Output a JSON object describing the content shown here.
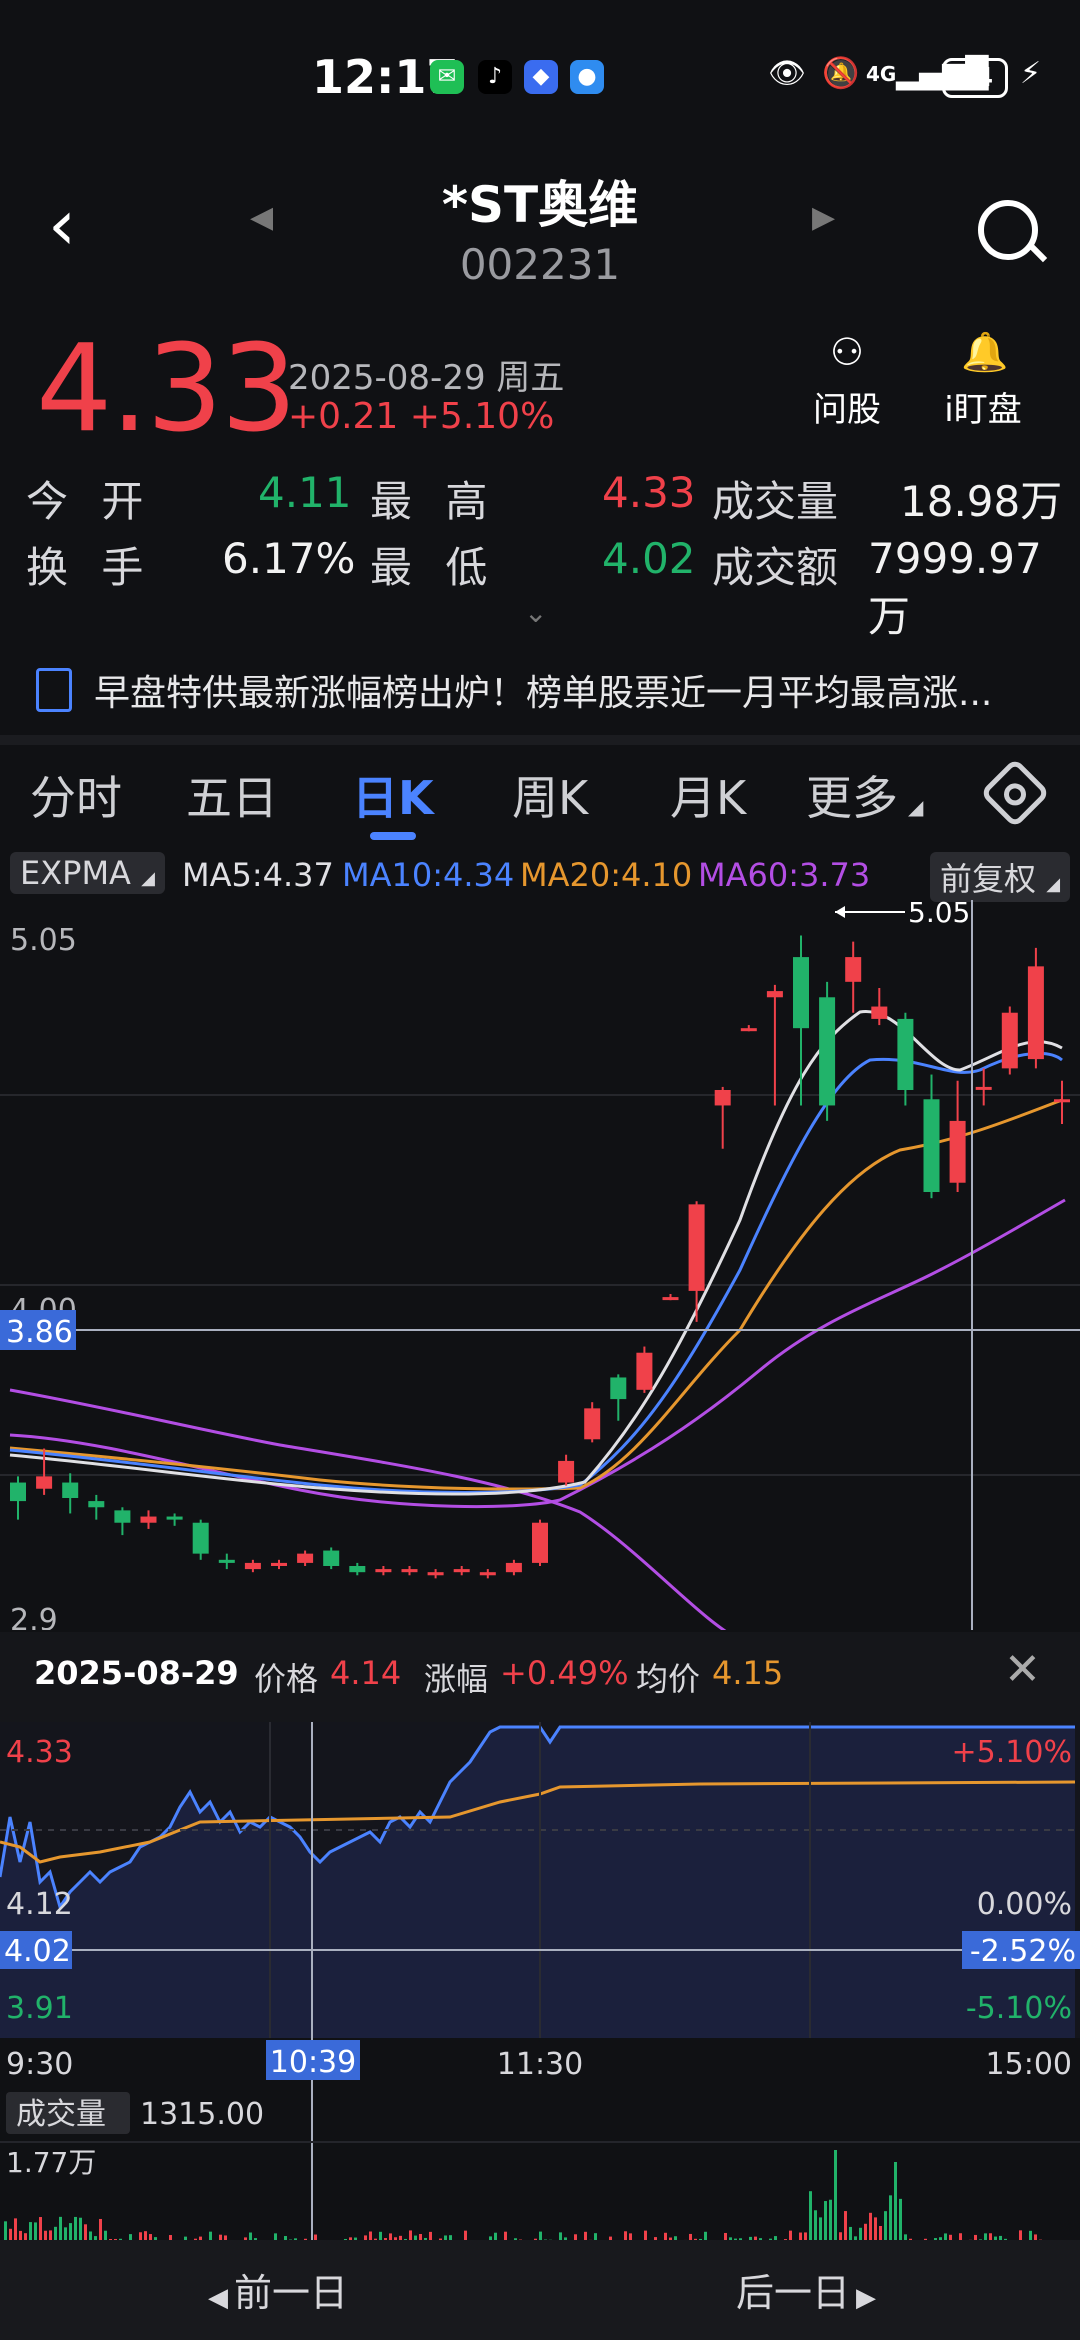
{
  "status_bar": {
    "time": "12:17",
    "apps": [
      "wechat-icon",
      "tiktok-icon",
      "baidu-icon",
      "browser-icon"
    ],
    "network": "4G",
    "battery": "94"
  },
  "header": {
    "title": "*ST奥维",
    "code": "002231"
  },
  "quote": {
    "price": "4.33",
    "date": "2025-08-29 周五",
    "change": "+0.21 +5.10%",
    "ask_label": "问股",
    "watch_label": "i盯盘"
  },
  "stats": {
    "open_label": "今 开",
    "open": "4.11",
    "high_label": "最 高",
    "high": "4.33",
    "volume_label": "成交量",
    "volume": "18.98万",
    "turnover_label": "换 手",
    "turnover": "6.17%",
    "low_label": "最 低",
    "low": "4.02",
    "amount_label": "成交额",
    "amount": "7999.97万"
  },
  "news": {
    "text": "早盘特供最新涨幅榜出炉！榜单股票近一月平均最高涨..."
  },
  "tabs": [
    {
      "label": "分时"
    },
    {
      "label": "五日"
    },
    {
      "label": "日K"
    },
    {
      "label": "周K"
    },
    {
      "label": "月K"
    },
    {
      "label": "更多"
    }
  ],
  "indicators": {
    "expma": "EXPMA",
    "ma5": "MA5:4.37",
    "ma10": "MA10:4.34",
    "ma20": "MA20:4.10",
    "ma60": "MA60:3.73",
    "adjust": "前复权",
    "colors": {
      "ma5": "#e0e0e4",
      "ma10": "#4b83ff",
      "ma20": "#e6972e",
      "ma60": "#b34ee4"
    }
  },
  "kline": {
    "y_top": "5.05",
    "y_mid": "4.00",
    "y_bottom": "2.9",
    "cursor_value": "3.86",
    "max_label": "5.05",
    "ylim": [
      2.9,
      5.1
    ],
    "candles": [
      {
        "o": 3.28,
        "c": 3.22,
        "h": 3.3,
        "l": 3.16
      },
      {
        "o": 3.26,
        "c": 3.3,
        "h": 3.39,
        "l": 3.24
      },
      {
        "o": 3.28,
        "c": 3.23,
        "h": 3.31,
        "l": 3.18
      },
      {
        "o": 3.22,
        "c": 3.2,
        "h": 3.24,
        "l": 3.16
      },
      {
        "o": 3.19,
        "c": 3.15,
        "h": 3.2,
        "l": 3.11
      },
      {
        "o": 3.15,
        "c": 3.17,
        "h": 3.19,
        "l": 3.13
      },
      {
        "o": 3.17,
        "c": 3.16,
        "h": 3.18,
        "l": 3.14
      },
      {
        "o": 3.15,
        "c": 3.05,
        "h": 3.16,
        "l": 3.03
      },
      {
        "o": 3.03,
        "c": 3.02,
        "h": 3.05,
        "l": 3.0
      },
      {
        "o": 3.0,
        "c": 3.02,
        "h": 3.03,
        "l": 2.99
      },
      {
        "o": 3.01,
        "c": 3.02,
        "h": 3.03,
        "l": 3.0
      },
      {
        "o": 3.02,
        "c": 3.05,
        "h": 3.06,
        "l": 3.01
      },
      {
        "o": 3.06,
        "c": 3.01,
        "h": 3.07,
        "l": 3.0
      },
      {
        "o": 3.01,
        "c": 2.99,
        "h": 3.02,
        "l": 2.98
      },
      {
        "o": 2.99,
        "c": 3.0,
        "h": 3.01,
        "l": 2.98
      },
      {
        "o": 2.99,
        "c": 3.0,
        "h": 3.01,
        "l": 2.98
      },
      {
        "o": 2.98,
        "c": 2.99,
        "h": 3.0,
        "l": 2.97
      },
      {
        "o": 2.99,
        "c": 3.0,
        "h": 3.01,
        "l": 2.98
      },
      {
        "o": 2.98,
        "c": 2.99,
        "h": 3.0,
        "l": 2.97
      },
      {
        "o": 2.99,
        "c": 3.02,
        "h": 3.03,
        "l": 2.98
      },
      {
        "o": 3.02,
        "c": 3.15,
        "h": 3.16,
        "l": 3.01
      },
      {
        "o": 3.28,
        "c": 3.35,
        "h": 3.37,
        "l": 3.27
      },
      {
        "o": 3.42,
        "c": 3.52,
        "h": 3.54,
        "l": 3.41
      },
      {
        "o": 3.62,
        "c": 3.55,
        "h": 3.63,
        "l": 3.48
      },
      {
        "o": 3.58,
        "c": 3.7,
        "h": 3.72,
        "l": 3.57
      },
      {
        "o": 3.88,
        "c": 3.88,
        "h": 3.89,
        "l": 3.87
      },
      {
        "o": 3.9,
        "c": 4.18,
        "h": 4.19,
        "l": 3.8
      },
      {
        "o": 4.5,
        "c": 4.55,
        "h": 4.56,
        "l": 4.36
      },
      {
        "o": 4.75,
        "c": 4.75,
        "h": 4.76,
        "l": 4.74
      },
      {
        "o": 4.85,
        "c": 4.87,
        "h": 4.89,
        "l": 4.5
      },
      {
        "o": 4.98,
        "c": 4.75,
        "h": 5.05,
        "l": 4.5
      },
      {
        "o": 4.85,
        "c": 4.5,
        "h": 4.9,
        "l": 4.45
      },
      {
        "o": 4.9,
        "c": 4.98,
        "h": 5.03,
        "l": 4.8
      },
      {
        "o": 4.78,
        "c": 4.82,
        "h": 4.88,
        "l": 4.76
      },
      {
        "o": 4.78,
        "c": 4.55,
        "h": 4.8,
        "l": 4.5
      },
      {
        "o": 4.52,
        "c": 4.22,
        "h": 4.6,
        "l": 4.2
      },
      {
        "o": 4.25,
        "c": 4.45,
        "h": 4.58,
        "l": 4.22
      },
      {
        "o": 4.56,
        "c": 4.56,
        "h": 4.62,
        "l": 4.5
      },
      {
        "o": 4.62,
        "c": 4.8,
        "h": 4.82,
        "l": 4.6
      },
      {
        "o": 4.65,
        "c": 4.95,
        "h": 5.01,
        "l": 4.62
      },
      {
        "o": 4.52,
        "c": 4.52,
        "h": 4.58,
        "l": 4.44
      }
    ]
  },
  "intraday": {
    "date": "2025-08-29",
    "price_label": "价格",
    "price": "4.14",
    "change_label": "涨幅",
    "change": "+0.49%",
    "avg_label": "均价",
    "avg": "4.15",
    "y_high": "4.33",
    "y_mid": "4.12",
    "y_low": "3.91",
    "pct_high": "+5.10%",
    "pct_mid": "0.00%",
    "pct_low": "-5.10%",
    "cursor_price": "4.02",
    "cursor_pct": "-2.52%",
    "t_start": "9:30",
    "t_cursor": "10:39",
    "t_mid": "11:30",
    "t_end": "15:00",
    "volume_label": "成交量",
    "volume": "1315.00",
    "vol_max": "1.77万"
  },
  "nav": {
    "prev": "前一日",
    "next": "后一日"
  }
}
